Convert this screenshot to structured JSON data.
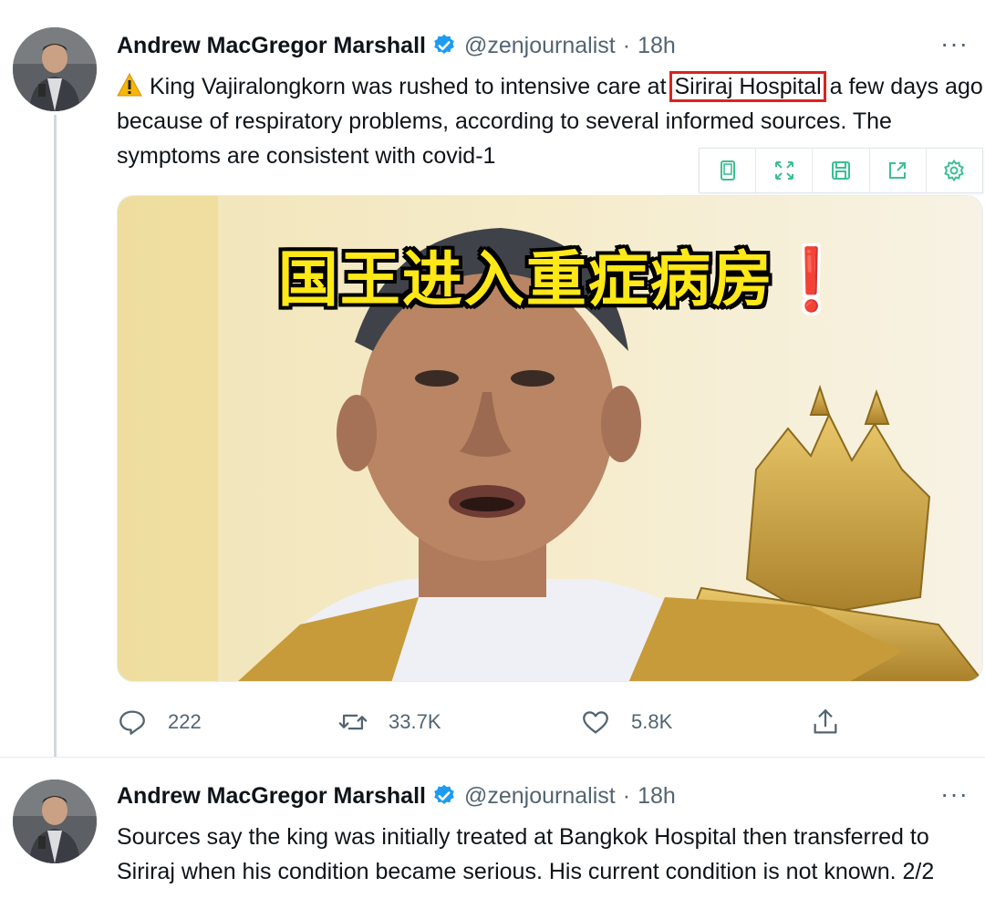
{
  "tweets": [
    {
      "author": "Andrew MacGregor Marshall",
      "handle": "@zenjournalist",
      "separator": "·",
      "time": "18h",
      "more": "···",
      "text_before": "King Vajiralongkorn was rushed to intensive care at",
      "text_highlight": "Siriraj Hospital",
      "text_after": "a few days ago because of respiratory problems, according to several informed sources. The symptoms are consistent with covid-1",
      "image_caption": "国王进入重症病房",
      "image_caption_mark": "❗",
      "metrics": {
        "replies": "222",
        "retweets": "33.7K",
        "likes": "5.8K"
      }
    },
    {
      "author": "Andrew MacGregor Marshall",
      "handle": "@zenjournalist",
      "separator": "·",
      "time": "18h",
      "more": "···",
      "text": "Sources say the king was initially treated at Bangkok Hospital then transferred to Siriraj when his condition became serious. His current condition is not known. 2/2"
    }
  ],
  "floating_toolbar": {
    "icons": [
      "tablet-icon",
      "expand-icon",
      "save-icon",
      "share-out-icon",
      "settings-icon"
    ],
    "color": "#3bbf94"
  },
  "icons": {
    "verified": "verified-badge-icon",
    "reply": "reply-icon",
    "retweet": "retweet-icon",
    "like": "heart-icon",
    "share": "share-icon",
    "warning": "warning-icon"
  },
  "colors": {
    "verified": "#1d9bf0",
    "highlight_box": "#d9241e",
    "caption_fill": "#ffe817",
    "secondary_text": "#536471"
  }
}
